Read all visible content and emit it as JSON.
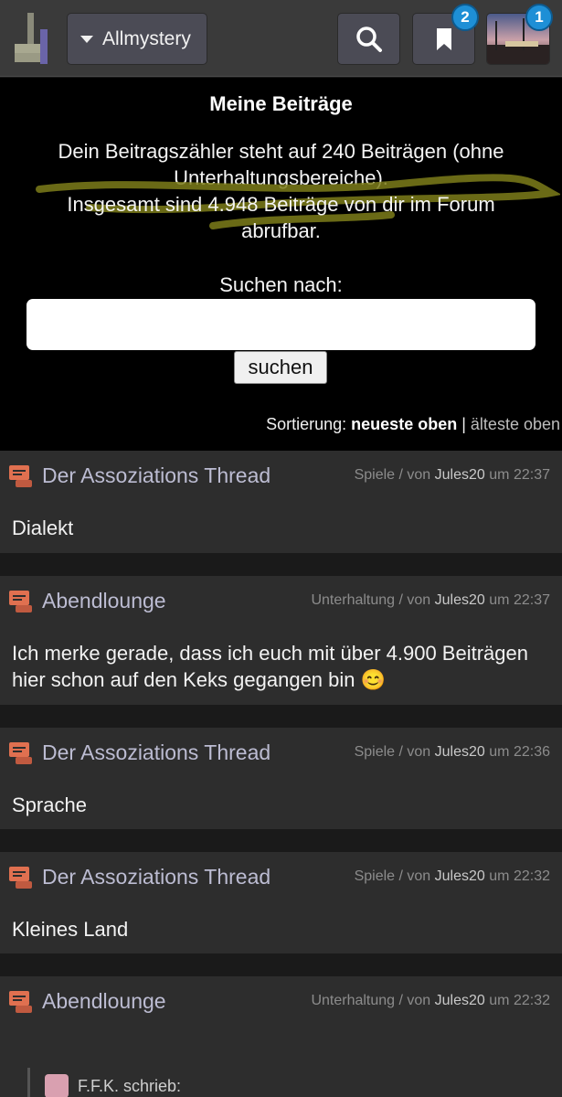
{
  "header": {
    "dropdown_label": "Allmystery",
    "bookmark_badge": "2",
    "avatar_badge": "1",
    "icons": [
      "logo-icon",
      "search-icon",
      "bookmark-icon",
      "avatar"
    ]
  },
  "info": {
    "title": "Meine Beiträge",
    "line1": "Dein Beitragszähler steht auf 240 Beiträgen (ohne Unterhaltungsbereiche).",
    "line2": "Insgesamt sind 4.948 Beiträge von dir im Forum abrufbar.",
    "search_label": "Suchen nach:",
    "search_value": "",
    "search_button": "suchen",
    "sort_prefix": "Sortierung:",
    "sort_active": "neueste oben",
    "sort_sep": "|",
    "sort_alt": "älteste oben"
  },
  "posts": [
    {
      "title": "Der Assoziations Thread",
      "category": "Spiele",
      "von": "/ von",
      "user": "Jules20",
      "um": "um",
      "time": "22:37",
      "body": "Dialekt"
    },
    {
      "title": "Abendlounge",
      "category": "Unterhaltung",
      "von": "/ von",
      "user": "Jules20",
      "um": "um",
      "time": "22:37",
      "body": "Ich merke gerade, dass ich euch mit über 4.900 Beiträgen hier schon auf den Keks gegangen bin 😊"
    },
    {
      "title": "Der Assoziations Thread",
      "category": "Spiele",
      "von": "/ von",
      "user": "Jules20",
      "um": "um",
      "time": "22:36",
      "body": "Sprache"
    },
    {
      "title": "Der Assoziations Thread",
      "category": "Spiele",
      "von": "/ von",
      "user": "Jules20",
      "um": "um",
      "time": "22:32",
      "body": "Kleines Land"
    },
    {
      "title": "Abendlounge",
      "category": "Unterhaltung",
      "von": "/ von",
      "user": "Jules20",
      "um": "um",
      "time": "22:32",
      "body": "",
      "quote": "F.F.K. schrieb:"
    }
  ],
  "colors": {
    "accent_badge": "#1e8fd6",
    "post_bg": "#2d2d2d",
    "title": "#bcbcd2",
    "highlight": "#8a8a1e"
  }
}
